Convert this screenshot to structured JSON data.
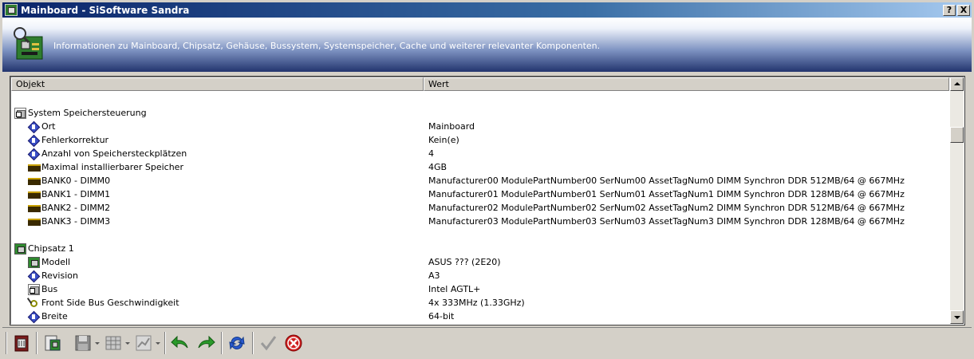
{
  "window": {
    "title": "Mainboard - SiSoftware Sandra",
    "help_button": "?",
    "close_button": "X"
  },
  "banner": {
    "description": "Informationen zu Mainboard, Chipsatz, Gehäuse, Bussystem, Systemspeicher, Cache und weiterer relevanter Komponenten."
  },
  "list": {
    "columns": [
      "Objekt",
      "Wert"
    ],
    "rows": [
      {
        "indent": 0,
        "icon": "folder-icon",
        "name": "System Speichersteuerung",
        "value": ""
      },
      {
        "indent": 1,
        "icon": "info-icon",
        "name": "Ort",
        "value": "Mainboard"
      },
      {
        "indent": 1,
        "icon": "info-icon",
        "name": "Fehlerkorrektur",
        "value": "Kein(e)"
      },
      {
        "indent": 1,
        "icon": "info-icon",
        "name": "Anzahl von Speichersteckplätzen",
        "value": "4"
      },
      {
        "indent": 1,
        "icon": "ram-icon",
        "name": "Maximal installierbarer Speicher",
        "value": "4GB"
      },
      {
        "indent": 1,
        "icon": "ram-icon",
        "name": "BANK0 - DIMM0",
        "value": "Manufacturer00 ModulePartNumber00 SerNum00 AssetTagNum0 DIMM Synchron DDR 512MB/64 @ 667MHz"
      },
      {
        "indent": 1,
        "icon": "ram-icon",
        "name": "BANK1 - DIMM1",
        "value": "Manufacturer01 ModulePartNumber01 SerNum01 AssetTagNum1 DIMM Synchron DDR 128MB/64 @ 667MHz"
      },
      {
        "indent": 1,
        "icon": "ram-icon",
        "name": "BANK2 - DIMM2",
        "value": "Manufacturer02 ModulePartNumber02 SerNum02 AssetTagNum2 DIMM Synchron DDR 512MB/64 @ 667MHz"
      },
      {
        "indent": 1,
        "icon": "ram-icon",
        "name": "BANK3 - DIMM3",
        "value": "Manufacturer03 ModulePartNumber03 SerNum03 AssetTagNum3 DIMM Synchron DDR 128MB/64 @ 667MHz"
      },
      {
        "indent": 0,
        "icon": "chip-icon",
        "name": "Chipsatz 1",
        "value": ""
      },
      {
        "indent": 1,
        "icon": "chip-icon",
        "name": "Modell",
        "value": "ASUS ??? (2E20)"
      },
      {
        "indent": 1,
        "icon": "info-icon",
        "name": "Revision",
        "value": "A3"
      },
      {
        "indent": 1,
        "icon": "folder-icon",
        "name": "Bus",
        "value": "Intel AGTL+"
      },
      {
        "indent": 1,
        "icon": "gauge-icon",
        "name": "Front Side Bus Geschwindigkeit",
        "value": "4x 333MHz (1.33GHz)"
      },
      {
        "indent": 1,
        "icon": "info-icon",
        "name": "Breite",
        "value": "64-bit"
      }
    ]
  },
  "toolbar": {
    "buttons": [
      "module-icon",
      "report-icon",
      "save-icon",
      "table-icon",
      "chart-icon",
      "back-icon",
      "forward-icon",
      "refresh-icon",
      "ok-icon",
      "cancel-icon"
    ]
  },
  "colors": {
    "title_bar": "#0a246a",
    "banner_dark": "#22346e",
    "window_face": "#d4d0c8",
    "arrow_green": "#2a9a2a",
    "refresh_blue": "#2a5ad0",
    "cancel_red": "#d02020"
  }
}
